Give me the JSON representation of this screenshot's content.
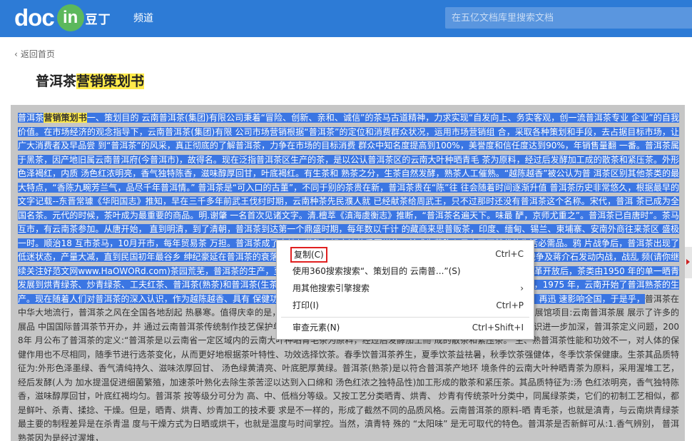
{
  "header": {
    "logo_text": "doc",
    "logo_in": "in",
    "logo_cn": "豆丁",
    "nav_channel": "频道",
    "search_placeholder": "在五亿文档库里搜索文档"
  },
  "back_link": "返回首页",
  "page_title": {
    "part1": "普洱茶",
    "part2_highlight": "营销策划书"
  },
  "document": {
    "lead": "普洱茶",
    "keyword": "营销策划书",
    "selected_text": "一、策划目的 云南普洱茶(集团)有限公司秉着“冒险、创新、亲和、诚信”的茶马古道精神，力求实现“自发向上、务实客观，创一流普洱茶专业 企业”的自我价值。在市场经济的观念指导下，云南普洱茶(集团)有限 公司市场营销根据“普洱茶”的定位和消费群众状况，运用市场营销组 合，采取各种策划和手段，去占据目标市场，让广大消费者及早品尝 到“普洱茶”的风采，真正彻底的了解普洱茶，力争在市场的目标消费 群众中知名度提高到100%，美誉度和信任度达到90%，年销售量翻 一番。普洱茶属于黑茶，因产地旧属云南普洱府(今普洱市)，故得名。现在泛指普洱茶区生产的茶，是以公认普洱茶区的云南大叶种晒青毛 茶为原料，经过后发酵加工成的散茶和紧压茶。外形色泽褐红，内质 汤色红浓明亮，香气独特陈香，滋味醇厚回甘，叶底褐红。有生茶和 熟茶之分，生茶自然发酵，熟茶人工催熟。“越陈越香”被公认为普 洱茶区别其他茶类的最大特点，“香陈九畹芳兰气，品尽千年普洱情。” 普洱茶是“可入口的古董”，不同于别的茶贵在新，普洱茶贵在“陈”往 往会随着时间逐渐升值 普洱茶历史非常悠久，根据最早的文字记载--东晋常璩《华阳国志》推知，早在三千多年前武王伐纣时期，云南种茶先民濮人就 已经献茶给周武王，只不过那时还没有普洱茶这个名称。宋代，普洱 茶已成为全国名茶。元代的时候，茶叶成为最重要的商品。明.谢肇 一名首次见诸文字。清.檀萃《滇海虞衡志》推断，“普洱茶名遍天下。味最 酽，京师尤重之”。普洱茶已自唐时”。茶马互市，有云南茶参加。从唐开始， 直到明清，到了清朝，普洱茶到达第一个鼎盛时期，每年数以千计 的藏商来思普贩茶，印度、缅甸、锡兰、柬埔寨、安南外商往来茶区 盛极一时。顺治18 互市茶马，10月开市，每年贸易茶 万担。普洱茶成了内地与藏胞友好交流的重要媒体，并成为藏胞心目中不可替代的生活必需品。鸦 片战争后，普洱茶出现了低迷状态，产量大减，直到民国初年最谷乡 绅纪豪延在普洱茶的衰落，到抗战爆发前，普洱茶的产量逐步回升。由于日本帝国主义侵华战争及蒋介石发动内战，战乱 频(请你继续关注好范文网www.HaOWORd.com)茶园荒芜，普洱茶的生产，至新中国成立时，普洱茶年产量下降到了5 万担，商品量仅 万担。改革开放后，茶类由1950 年的单一晒青发展到烘青绿茶、炒青绿茶、工夫红茶、普洱茶(熟茶)和普洱茶(生茶)等多种茶类。普洱茶迎来了又一个辉煌时期。但是，值得一提 的是，1975 年，云南开始了普洱熟茶的生产。现在随着人们对普洱茶的深入认识，作为越陈越香、具有 保健功能和 迷人口感的普洱茶，流行之势从南洋港台传至广东，回及云南，再迅 速影响全国，于是乎，",
    "plain_text": "普洱茶在中华大地流行，普洱茶之风在全国各地刮起 热暴寒。值得庆幸的是，此期间传统的普洱 茶传统工艺得到恢复，云南省博物馆增加了一个展馆项目:云南普洱茶展 展示了许多的展品 中国国际普洱茶节开办，并 通过云南普洱茶传统制作技艺保护单位推广普洱茶文化，保护普洱茶 传统制作技艺。人们对普洱茶的认识进一步加深，普洱茶定义问题，2008年 月公布了普洱茶的定义:“普洱茶是以云南省一定区域内的云南大叶种晒青毛茶为原料，经过后发酵加工而 成的散茶和紧压茶。” 生、熟普洱茶性能和功效不一，对人体的保健作用也不尽相同，随季节进行选茶变化，从而更好地根据茶叶特性、功效选择饮茶。春季饮普洱茶养生，夏季饮茶益祛暑，秋季饮茶强健体，冬季饮茶保健康。生茶其品质特征为:外形色泽墨绿、香气清纯持久、滋味浓厚回甘、 汤色绿黄清亮、叶底肥厚黄绿。普洱茶(熟茶)是以符合普洱茶产地环 境条件的云南大叶种晒青茶为原料，采用渥堆工艺，经后发酵(人为 加水提温促进细菌繁殖，加速茶叶熟化去除生茶苦涩以达到入口绵和 汤色红浓之独特品性)加工形成的散茶和紧压茶。其品质特征为:汤 色红浓明亮，香气独特陈香，滋味醇厚回甘，叶底红褐均匀。普洱茶 按等级分可分为 高、中、低档分等级。又按工艺分类晒青、烘青、 炒青有传统茶叶分类中，同属绿茶类，它们的初制工艺相似，都 是鲜叶、杀青、揉捻、干燥。但是，晒青、烘青、炒青加工的技术要 求是不一样的，形成了截然不同的品质风格。云南普洱茶的原料-晒 青毛茶，也就是滇青，与云南烘青绿茶最主要的制程差异是在杀青温 度与干燥方式为日晒或烘干，也就是温度与时间掌控。当然，滇青特 殊的 “太阳味” 是无可取代的特色。普洱茶是否新鲜可从:1.香气辨别， 普洱熟茶因为是经过渥堆，"
  },
  "context_menu": {
    "items": [
      {
        "label": "复制(C)",
        "shortcut": "Ctrl+C"
      },
      {
        "label": "使用360搜索搜索“、策划目的 云南普...”(S)",
        "shortcut": ""
      },
      {
        "label": "用其他搜索引擎搜索",
        "shortcut": "›"
      },
      {
        "label": "打印(I)",
        "shortcut": "Ctrl+P"
      },
      {
        "label": "审查元素(N)",
        "shortcut": "Ctrl+Shift+I"
      }
    ]
  },
  "colors": {
    "header_bg": "#2d7bd6",
    "selection_bg": "#3b76e3",
    "highlight": "#ffea4a",
    "doc_bg": "#c6c6c6",
    "logo_badge": "#5cb85c"
  }
}
